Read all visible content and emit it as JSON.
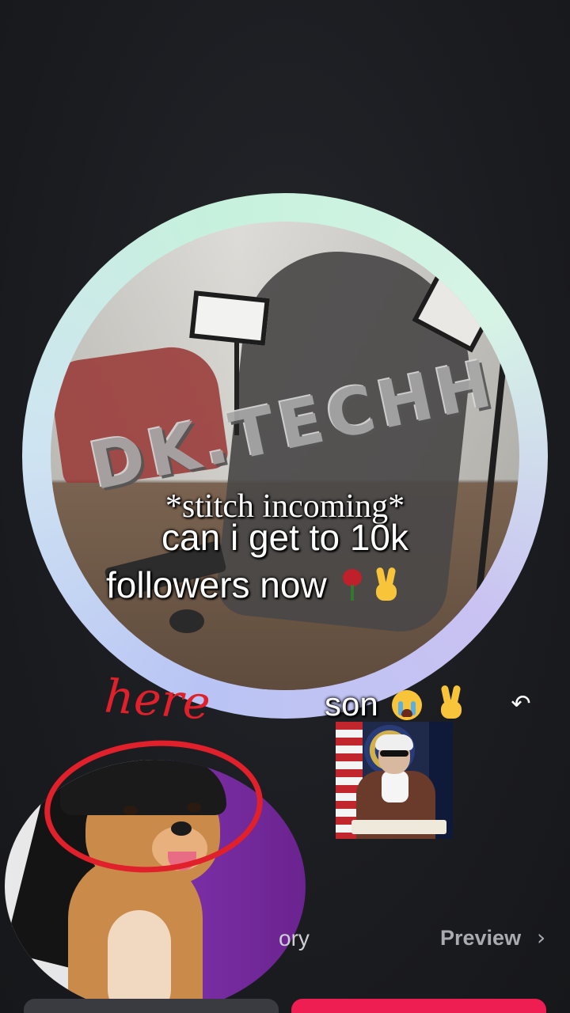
{
  "profile": {
    "logo_text": "DK.TECHH"
  },
  "captions": {
    "stitch": "*stitch incoming*",
    "line1": "can i get to 10k",
    "line2": "followers now",
    "son": "son",
    "here": "here"
  },
  "bottom": {
    "story_label": "ory",
    "preview_label": "Preview",
    "preview_chevron": "›",
    "share_icon": "↶"
  },
  "colors": {
    "ring_gradient": [
      "#b9c4f4",
      "#cfe4f2",
      "#c6f1dc",
      "#c9c2f2"
    ],
    "doodle_red": "#e0202a",
    "primary_button": "#ee1d52",
    "secondary_button": "#3a3b40",
    "background": "#1b1c20"
  },
  "icons": [
    "rose-emoji-icon",
    "peace-hand-icon",
    "crying-face-icon",
    "share-arrow-icon",
    "chevron-right-icon"
  ]
}
